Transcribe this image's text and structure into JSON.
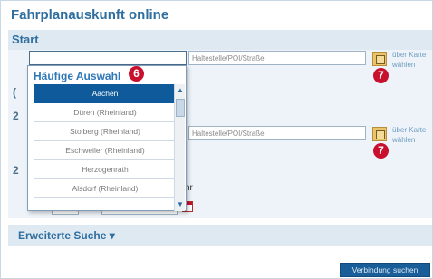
{
  "title": "Fahrplanauskunft online",
  "start_section": {
    "label": "Start"
  },
  "start": {
    "type_placeholder": "Haltestelle/POI/Straße",
    "map_link": [
      "über Karte",
      "wählen"
    ]
  },
  "ziel": {
    "type_placeholder": "Haltestelle/POI/Straße",
    "map_link": [
      "über Karte",
      "wählen"
    ]
  },
  "hidden_labels": {
    "s1": "(",
    "s2": "2",
    "s3": "2"
  },
  "time_suffix": "hr",
  "dropdown": {
    "heading": "Häufige Auswahl",
    "items": [
      "Aachen",
      "Düren (Rheinland)",
      "Stolberg (Rheinland)",
      "Eschweiler (Rheinland)",
      "Herzogenrath",
      "Alsdorf (Rheinland)"
    ],
    "selected_index": 0
  },
  "badges": {
    "dropdown": "6",
    "map1": "7",
    "map2": "7"
  },
  "extended_search": "Erweiterte Suche ▾",
  "submit_label": "Verbindung suchen",
  "colors": {
    "accent": "#2f6fa0",
    "selected": "#0e5a9a",
    "badge": "#c8102e",
    "panel": "#dfe9f2"
  }
}
